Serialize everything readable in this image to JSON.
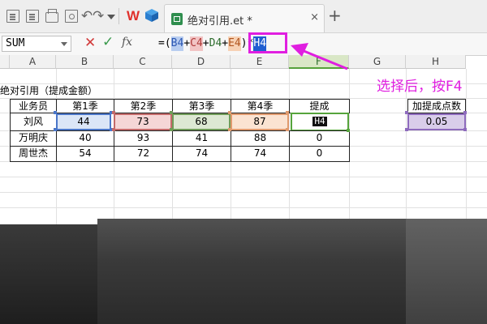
{
  "toolbar": {
    "file_tab_label": "绝对引用.et *",
    "close_glyph": "×",
    "new_tab_glyph": "+",
    "undo_glyph": "↶",
    "redo_glyph": "↷",
    "logo_text": "W"
  },
  "formula_bar": {
    "name_box": "SUM",
    "cancel_glyph": "✕",
    "confirm_glyph": "✓",
    "fx_label": "fx",
    "formula_parts": [
      "=(",
      "B4",
      "+",
      "C4",
      "+",
      "D4",
      "+",
      "E4",
      ")",
      "*",
      "H4"
    ]
  },
  "columns": [
    "A",
    "B",
    "C",
    "D",
    "E",
    "F",
    "G",
    "H"
  ],
  "sheet": {
    "title": "绝对引用（提成金额）",
    "headers": [
      "业务员",
      "第1季",
      "第2季",
      "第3季",
      "第4季",
      "提成"
    ],
    "rows": [
      [
        "刘风",
        "44",
        "73",
        "68",
        "87",
        "H4"
      ],
      [
        "万明庆",
        "40",
        "93",
        "41",
        "88",
        "0"
      ],
      [
        "周世杰",
        "54",
        "72",
        "74",
        "74",
        "0"
      ]
    ],
    "extra_header": "加提成点数",
    "extra_value": "0.05"
  },
  "annotation": "选择后，按F4",
  "colors": {
    "accent_magenta": "#e01fe0",
    "ref_blue": "#4a76c8",
    "ref_red": "#c46a6a",
    "ref_green": "#6f9b58",
    "ref_orange": "#e09a6e",
    "ref_purple": "#8e6bbd",
    "active_green": "#56a43c"
  },
  "icons": [
    "new-document-icon",
    "save-icon",
    "print-icon",
    "print-preview-icon",
    "undo-icon",
    "redo-icon",
    "customize-toolbar-icon",
    "wps-logo-icon",
    "cube-icon",
    "spreadsheet-file-icon"
  ]
}
